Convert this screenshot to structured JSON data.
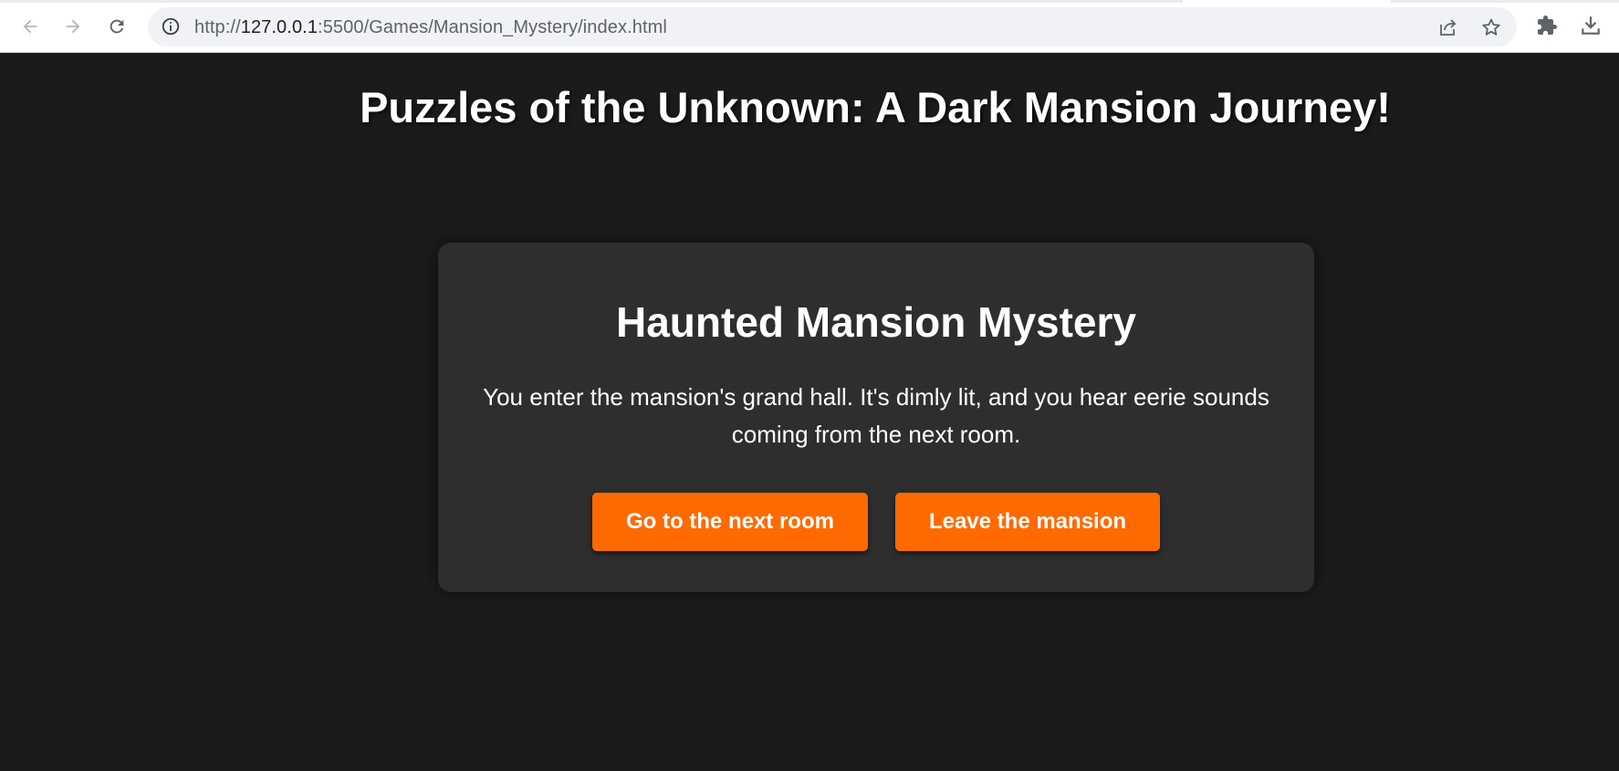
{
  "browser": {
    "url_prefix": "http://",
    "url_host": "127.0.0.1",
    "url_rest": ":5500/Games/Mansion_Mystery/index.html",
    "icons": {
      "back": "back-arrow-icon",
      "forward": "forward-arrow-icon",
      "reload": "reload-icon",
      "info": "info-icon",
      "share": "share-icon",
      "bookmark": "star-icon",
      "extensions": "puzzle-icon",
      "downloads": "download-icon"
    }
  },
  "page": {
    "title": "Puzzles of the Unknown: A Dark Mansion Journey!"
  },
  "game": {
    "heading": "Haunted Mansion Mystery",
    "description": "You enter the mansion's grand hall. It's dimly lit, and you hear eerie sounds coming from the next room.",
    "choices": [
      {
        "label": "Go to the next room"
      },
      {
        "label": "Leave the mansion"
      }
    ]
  },
  "colors": {
    "background": "#1b1b1b",
    "card": "#2e2e2e",
    "accent": "#ff6a00",
    "text": "#ffffff"
  }
}
